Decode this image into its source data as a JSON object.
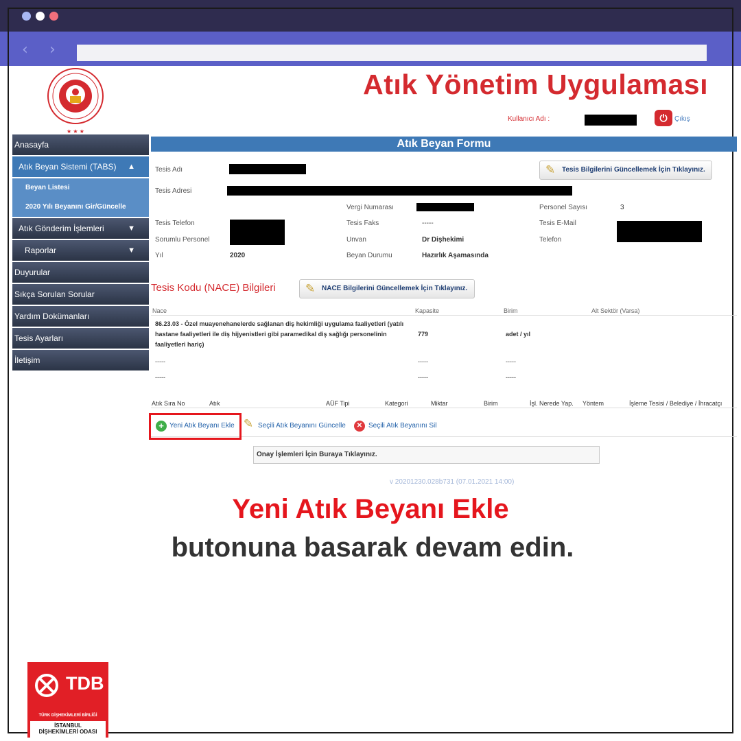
{
  "header": {
    "app_title": "Atık Yönetim Uygulaması",
    "user_label": "Kullanıcı Adı :",
    "exit_label": "Çıkış"
  },
  "sidebar": {
    "items": [
      {
        "label": "Anasayfa"
      },
      {
        "label": "Atık Beyan Sistemi (TABS)"
      },
      {
        "label": "Beyan Listesi"
      },
      {
        "label": "2020 Yılı Beyanını Gir/Güncelle"
      },
      {
        "label": "Atık Gönderim İşlemleri"
      },
      {
        "label": "Raporlar"
      },
      {
        "label": "Duyurular"
      },
      {
        "label": "Sıkça Sorulan Sorular"
      },
      {
        "label": "Yardım Dokümanları"
      },
      {
        "label": "Tesis Ayarları"
      },
      {
        "label": "İletişim"
      }
    ]
  },
  "form": {
    "title": "Atık Beyan Formu",
    "update_facility_button": "Tesis Bilgilerini Güncellemek İçin Tıklayınız.",
    "fields": {
      "tesis_adi": "Tesis Adı",
      "tesis_adresi": "Tesis Adresi",
      "vergi_numarasi": "Vergi Numarası",
      "personel_sayisi": "Personel Sayısı",
      "personel_sayisi_value": "3",
      "tesis_telefon": "Tesis Telefon",
      "tesis_faks": "Tesis Faks",
      "tesis_faks_value": "-----",
      "tesis_email": "Tesis E-Mail",
      "sorumlu_personel": "Sorumlu Personel",
      "unvan": "Unvan",
      "unvan_value": "Dr Dişhekimi",
      "telefon": "Telefon",
      "yil": "Yıl",
      "yil_value": "2020",
      "beyan_durumu": "Beyan Durumu",
      "beyan_durumu_value": "Hazırlık Aşamasında"
    }
  },
  "nace": {
    "title": "Tesis Kodu (NACE) Bilgileri",
    "update_button": "NACE Bilgilerini Güncellemek İçin Tıklayınız.",
    "columns": [
      "Nace",
      "Kapasite",
      "Birim",
      "Alt Sektör (Varsa)"
    ],
    "rows": [
      {
        "nace": "86.23.03 - Özel muayenehanelerde sağlanan diş hekimliği uygulama faaliyetleri (yatılı hastane faaliyetleri ile diş hijyenistleri gibi paramedikal diş sağlığı personelinin faaliyetleri hariç)",
        "kapasite": "779",
        "birim": "adet / yıl"
      },
      {
        "nace": "-----",
        "kapasite": "-----",
        "birim": "-----"
      },
      {
        "nace": "-----",
        "kapasite": "-----",
        "birim": "-----"
      }
    ]
  },
  "waste_table": {
    "columns": [
      "Atık Sıra No",
      "Atık",
      "AÜF Tipi",
      "Kategori",
      "Miktar",
      "Birim",
      "İşl. Nerede Yap.",
      "Yöntem",
      "İşleme Tesisi / Belediye / İhracatçı"
    ]
  },
  "actions": {
    "add": "Yeni Atık Beyanı Ekle",
    "update": "Seçili Atık Beyanını Güncelle",
    "delete": "Seçili Atık Beyanını Sil",
    "approve": "Onay İşlemleri İçin Buraya Tıklayınız."
  },
  "version": "v 20201230.028b731 (07.01.2021 14:00)",
  "caption": {
    "line1": "Yeni Atık Beyanı Ekle",
    "line2": "butonuna basarak devam edin."
  },
  "brand": {
    "name": "TDB",
    "line1": "TÜRK DİŞHEKİMLERİ BİRLİĞİ",
    "line2a": "İSTANBUL",
    "line2b": "DİŞHEKİMLERİ ODASI"
  },
  "colors": {
    "accent_red": "#d42a2f",
    "form_blue": "#3e79b6",
    "chrome_dark": "#2f2c4f",
    "chrome_blue": "#5b5fc7"
  }
}
